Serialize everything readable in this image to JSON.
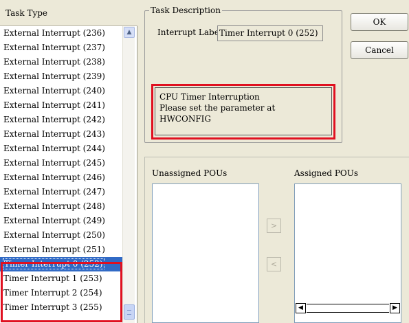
{
  "task_type": {
    "header": "Task Type",
    "items": [
      "External Interrupt (236)",
      "External Interrupt (237)",
      "External Interrupt (238)",
      "External Interrupt (239)",
      "External Interrupt (240)",
      "External Interrupt (241)",
      "External Interrupt (242)",
      "External Interrupt (243)",
      "External Interrupt (244)",
      "External Interrupt (245)",
      "External Interrupt (246)",
      "External Interrupt (247)",
      "External Interrupt (248)",
      "External Interrupt (249)",
      "External Interrupt (250)",
      "External Interrupt (251)",
      "Timer Interrupt 0 (252)",
      "Timer Interrupt 1 (253)",
      "Timer Interrupt 2 (254)",
      "Timer Interrupt 3 (255)"
    ],
    "selected": "Timer Interrupt 0 (252)"
  },
  "task_description": {
    "title": "Task Description",
    "interrupt_label": "Interrupt Labe",
    "interrupt_value": "Timer Interrupt 0 (252)",
    "description_lines": [
      "CPU Timer Interruption",
      "Please set the parameter at",
      "HWCONFIG"
    ]
  },
  "buttons": {
    "ok": "OK",
    "cancel": "Cancel"
  },
  "pous": {
    "unassigned_title": "Unassigned POUs",
    "assigned_title": "Assigned POUs",
    "move_right": ">",
    "move_left": "<"
  },
  "colors": {
    "highlight_red": "#e01020",
    "selection_blue": "#316ac5"
  }
}
